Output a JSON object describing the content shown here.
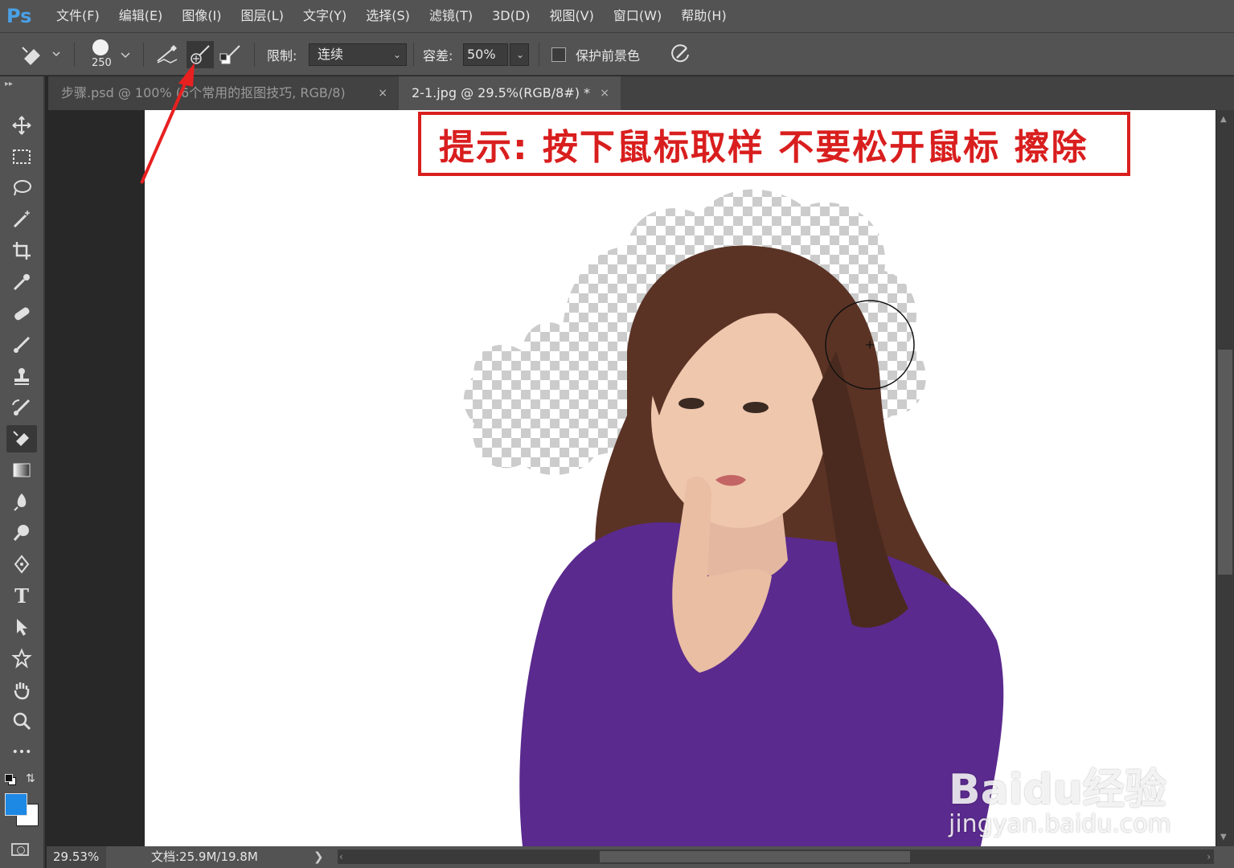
{
  "app": {
    "logo": "Ps"
  },
  "menu": [
    "文件(F)",
    "编辑(E)",
    "图像(I)",
    "图层(L)",
    "文字(Y)",
    "选择(S)",
    "滤镜(T)",
    "3D(D)",
    "视图(V)",
    "窗口(W)",
    "帮助(H)"
  ],
  "options": {
    "tool_icon": "background-eraser-icon",
    "brush_size": "250",
    "sampling_icons": [
      "sampling-continuous-icon",
      "sampling-once-icon",
      "sampling-background-swatch-icon"
    ],
    "limit_label": "限制:",
    "limit_value": "连续",
    "tolerance_label": "容差:",
    "tolerance_value": "50%",
    "protect_label": "保护前景色",
    "protect_checked": false,
    "pressure_icon": "pen-pressure-icon"
  },
  "tabs": [
    {
      "label": "步骤.psd @ 100% (6个常用的抠图技巧, RGB/8)",
      "active": false,
      "close": "×"
    },
    {
      "label": "2-1.jpg @ 29.5%(RGB/8#) *",
      "active": true,
      "close": "×"
    }
  ],
  "toolbar": {
    "tools": [
      "move-icon",
      "marquee-icon",
      "lasso-icon",
      "magic-wand-icon",
      "crop-icon",
      "eyedropper-icon",
      "healing-brush-icon",
      "brush-icon",
      "clone-stamp-icon",
      "history-brush-icon",
      "background-eraser-icon",
      "gradient-icon",
      "blur-icon",
      "dodge-icon",
      "pen-icon",
      "type-icon",
      "path-selection-icon",
      "custom-shape-icon",
      "hand-icon",
      "zoom-icon",
      "more-tools-icon"
    ],
    "active_tool": "background-eraser-icon",
    "foreground_color": "#1e88e5",
    "background_color": "#ffffff",
    "type_glyph": "T",
    "more_glyph": "•••"
  },
  "canvas": {
    "hint": "提示: 按下鼠标取样 不要松开鼠标 擦除",
    "hint_color": "#d91e1e",
    "watermark": "Baidu经验",
    "watermark_url": "jingyan.baidu.com"
  },
  "status": {
    "zoom": "29.53%",
    "doc": "文档:25.9M/19.8M",
    "arrow": "❯"
  }
}
